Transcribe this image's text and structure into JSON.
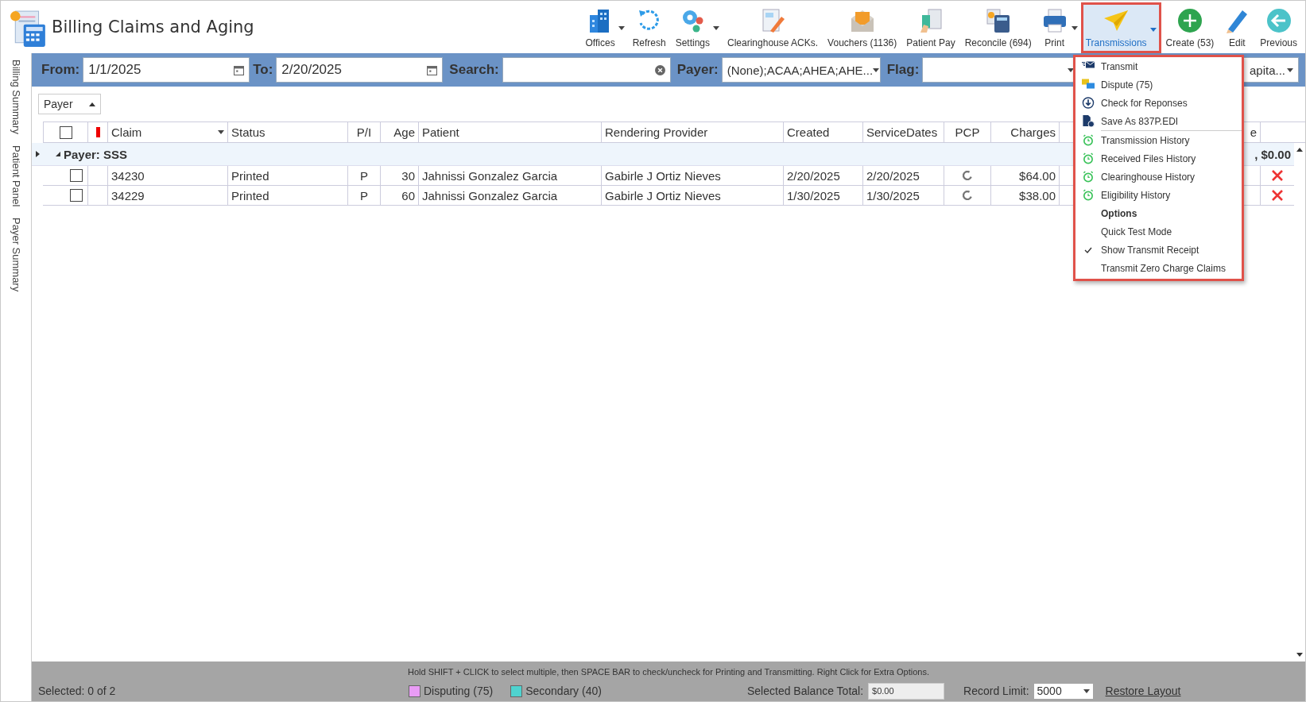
{
  "window": {
    "title": "Billing Claims and Aging"
  },
  "toolbar": [
    {
      "label": "Offices",
      "kind": "offices",
      "dropdown": true,
      "selected": false
    },
    {
      "label": "Refresh",
      "kind": "refresh",
      "dropdown": false,
      "selected": false
    },
    {
      "label": "Settings",
      "kind": "settings",
      "dropdown": true,
      "selected": false
    },
    {
      "label": "Clearinghouse ACKs.",
      "kind": "document",
      "dropdown": false,
      "selected": false
    },
    {
      "label": "Vouchers (1136)",
      "kind": "voucher",
      "dropdown": false,
      "selected": false
    },
    {
      "label": "Patient Pay",
      "kind": "pay",
      "dropdown": false,
      "selected": false
    },
    {
      "label": "Reconcile (694)",
      "kind": "calculator",
      "dropdown": false,
      "selected": false
    },
    {
      "label": "Print",
      "kind": "print",
      "dropdown": true,
      "selected": false
    },
    {
      "label": "Transmissions",
      "kind": "plane",
      "dropdown": true,
      "selected": true
    },
    {
      "label": "Create (53)",
      "kind": "create",
      "dropdown": false,
      "selected": false
    },
    {
      "label": "Edit",
      "kind": "edit",
      "dropdown": false,
      "selected": false
    },
    {
      "label": "Previous",
      "kind": "previous",
      "dropdown": false,
      "selected": false
    }
  ],
  "side_tabs": [
    "Billing Summary",
    "Patient Panel",
    "Payer Summary"
  ],
  "filters": {
    "from_label": "From:",
    "from": "1/1/2025",
    "to_label": "To:",
    "to": "2/20/2025",
    "search_label": "Search:",
    "payer_label": "Payer:",
    "payer": "(None);ACAA;AHEA;AHE...",
    "flag_label": "Flag:",
    "extra": "apita..."
  },
  "group_by": "Payer",
  "table": {
    "select_all": {
      "checked": false
    },
    "columns": [
      "Claim",
      "Status",
      "P/I",
      "Age",
      "Patient",
      "Rendering Provider",
      "Created",
      "ServiceDates",
      "PCP",
      "Charges",
      "e"
    ],
    "group": {
      "label": "Payer: SSS",
      "total": ", $0.00",
      "expanded": true
    },
    "rows": [
      {
        "checked": false,
        "cells": [
          "34230",
          "Printed",
          "P",
          "30",
          "Jahnissi Gonzalez Garcia",
          "Gabirle J Ortiz Nieves",
          "2/20/2025",
          "2/20/2025",
          "",
          "$64.00",
          ""
        ]
      },
      {
        "checked": false,
        "cells": [
          "34229",
          "Printed",
          "P",
          "60",
          "Jahnissi Gonzalez Garcia",
          "Gabirle J Ortiz Nieves",
          "1/30/2025",
          "1/30/2025",
          "",
          "$38.00",
          ""
        ]
      }
    ]
  },
  "menu": {
    "items": [
      {
        "label": "Transmit",
        "kind": "transmit"
      },
      {
        "label": "Dispute (75)",
        "kind": "dispute"
      },
      {
        "label": "Check for Reponses",
        "kind": "check"
      },
      {
        "label": "Save As 837P.EDI",
        "kind": "save"
      },
      {
        "label": "Transmission History",
        "kind": "history",
        "separator": true
      },
      {
        "label": "Received Files History",
        "kind": "history"
      },
      {
        "label": "Clearinghouse History",
        "kind": "history"
      },
      {
        "label": "Eligibility History",
        "kind": "history"
      },
      {
        "label": "Options",
        "kind": "header"
      },
      {
        "label": "Quick Test Mode",
        "kind": "option",
        "checked": false
      },
      {
        "label": "Show Transmit Receipt",
        "kind": "option",
        "checked": true
      },
      {
        "label": "Transmit Zero Charge Claims",
        "kind": "option",
        "checked": false
      }
    ]
  },
  "status_bar": {
    "hint": "Hold SHIFT + CLICK to select multiple, then SPACE BAR to check/uncheck for Printing and Transmitting. Right Click for Extra Options.",
    "selected": "Selected: 0 of 2",
    "legend": [
      {
        "label": "Disputing (75)",
        "color": "#e99cf5"
      },
      {
        "label": "Secondary (40)",
        "color": "#4fd3cf"
      }
    ],
    "balance_label": "Selected Balance Total:",
    "balance": "$0.00",
    "limit_label": "Record Limit:",
    "limit": "5000",
    "restore": "Restore Layout"
  }
}
